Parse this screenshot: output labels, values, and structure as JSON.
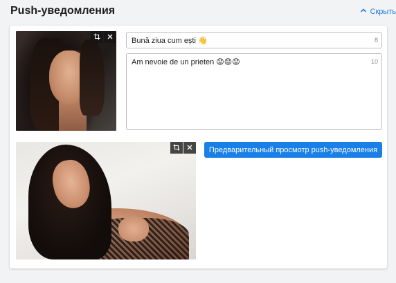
{
  "header": {
    "title": "Push-уведомления",
    "hide_label": "Скрыть"
  },
  "push": {
    "title_value": "Bună ziua cum ești 👋",
    "title_count": "8",
    "body_value": "Am nevoie de un prieten 😟😟😟",
    "body_count": "10",
    "preview_button": "Предварительный просмотр push-уведомления"
  },
  "icons": {
    "collapse": "chevron-up-icon",
    "crop": "crop-icon",
    "close": "close-icon"
  },
  "colors": {
    "accent": "#1a7fe6",
    "link": "#1e7be0",
    "background": "#f2f3f5",
    "card": "#ffffff"
  }
}
